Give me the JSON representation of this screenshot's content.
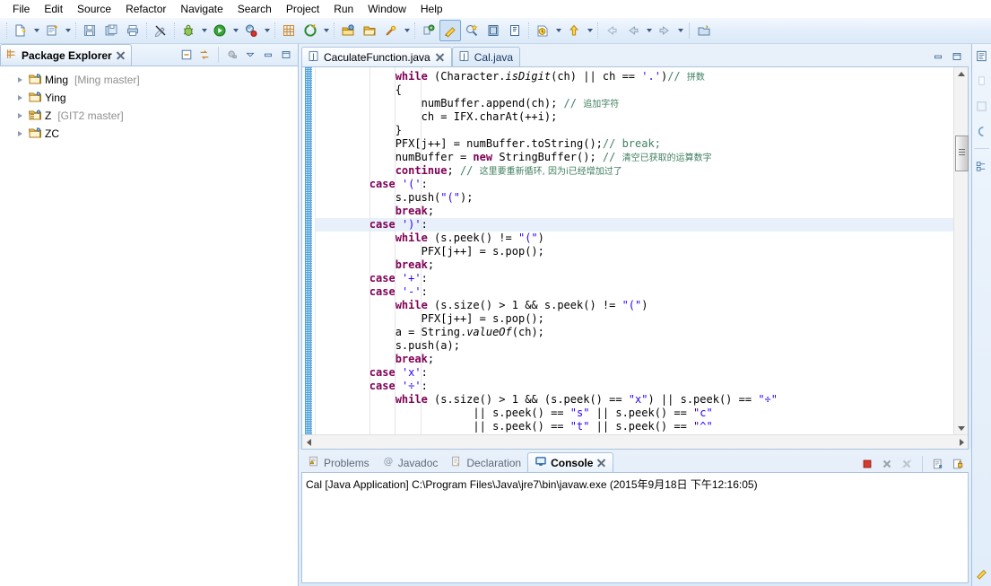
{
  "app": {
    "title": "Eclipse IDE"
  },
  "menubar": {
    "items": [
      {
        "label": "File"
      },
      {
        "label": "Edit"
      },
      {
        "label": "Source"
      },
      {
        "label": "Refactor"
      },
      {
        "label": "Navigate"
      },
      {
        "label": "Search"
      },
      {
        "label": "Project"
      },
      {
        "label": "Run"
      },
      {
        "label": "Window"
      },
      {
        "label": "Help"
      }
    ]
  },
  "toolbar": {
    "items": [
      {
        "name": "new-icon",
        "tip": "New"
      },
      {
        "name": "new-dropdown-arrow-icon",
        "tip": "New menu"
      },
      {
        "name": "new-java-class-icon",
        "tip": "New Java Class"
      },
      {
        "name": "new-java-class-dropdown-arrow-icon",
        "tip": "New Java Class menu"
      },
      {
        "name": "save-icon",
        "tip": "Save"
      },
      {
        "name": "save-all-icon",
        "tip": "Save All"
      },
      {
        "name": "print-icon",
        "tip": "Print"
      },
      {
        "name": "toggle-mark-occurrences-icon",
        "tip": "Toggle Mark Occurrences"
      },
      {
        "name": "debug-icon",
        "tip": "Debug"
      },
      {
        "name": "debug-dropdown-arrow-icon",
        "tip": "Debug menu"
      },
      {
        "name": "run-icon",
        "tip": "Run"
      },
      {
        "name": "run-dropdown-arrow-icon",
        "tip": "Run menu"
      },
      {
        "name": "external-tools-icon",
        "tip": "External Tools"
      },
      {
        "name": "external-tools-dropdown-arrow-icon",
        "tip": "External Tools menu"
      },
      {
        "name": "new-package-icon",
        "tip": "New Java Package"
      },
      {
        "name": "open-type-icon",
        "tip": "Open Type"
      },
      {
        "name": "open-type-dropdown-arrow-icon",
        "tip": "Open Type menu"
      },
      {
        "name": "open-task-icon",
        "tip": "Open Task"
      },
      {
        "name": "search-folder-icon",
        "tip": "Search"
      },
      {
        "name": "link-icon",
        "tip": "Link"
      },
      {
        "name": "link-dropdown-arrow-icon",
        "tip": "Link menu"
      },
      {
        "name": "next-annotation-icon",
        "tip": "Next Annotation"
      },
      {
        "name": "pencil-highlight-icon",
        "tip": "Toggle Highlight"
      },
      {
        "name": "search-ref-icon",
        "tip": "Search References"
      },
      {
        "name": "show-whitespace-icon",
        "tip": "Show Whitespace Characters"
      },
      {
        "name": "show-print-margin-icon",
        "tip": "Show Print Margin"
      },
      {
        "name": "previous-edit-icon",
        "tip": "Previous Edit Location"
      },
      {
        "name": "previous-edit-dropdown-arrow-icon",
        "tip": "Previous Edit menu"
      },
      {
        "name": "next-edit-icon",
        "tip": "Next Edit Location"
      },
      {
        "name": "next-edit-dropdown-arrow-icon",
        "tip": "Next Edit menu"
      },
      {
        "name": "back-icon",
        "tip": "Back"
      },
      {
        "name": "back-dropdown-arrow-icon",
        "tip": "Back menu"
      },
      {
        "name": "forward-icon",
        "tip": "Forward"
      },
      {
        "name": "forward-dropdown-arrow-icon",
        "tip": "Forward menu"
      },
      {
        "name": "open-perspective-icon",
        "tip": "Open Perspective"
      }
    ]
  },
  "package_explorer": {
    "tab_label": "Package Explorer",
    "tools": [
      {
        "name": "collapse-all-icon"
      },
      {
        "name": "link-with-editor-icon"
      },
      {
        "name": "focus-on-active-task-icon"
      },
      {
        "name": "view-menu-icon"
      },
      {
        "name": "minimize-icon"
      },
      {
        "name": "maximize-icon"
      }
    ],
    "tree": [
      {
        "label": "Ming",
        "branch": "[Ming master]",
        "icon": "java-project-icon"
      },
      {
        "label": "Ying",
        "branch": "",
        "icon": "java-project-icon"
      },
      {
        "label": "Z",
        "branch": "[GIT2 master]",
        "icon": "java-project-icon"
      },
      {
        "label": "ZC",
        "branch": "",
        "icon": "java-project-icon"
      }
    ]
  },
  "editor": {
    "tabs": [
      {
        "label": "CaculateFunction.java",
        "active": true,
        "closable": true,
        "icon": "java-file-icon"
      },
      {
        "label": "Cal.java",
        "active": false,
        "closable": false,
        "icon": "java-file-icon"
      }
    ],
    "tools": [
      {
        "name": "minimize-icon"
      },
      {
        "name": "maximize-icon"
      }
    ],
    "highlighted_line_index": 11,
    "lines": [
      {
        "indent": 12,
        "tokens": [
          {
            "t": "while",
            "c": "kw"
          },
          {
            "t": " (Character.",
            "c": "plain"
          },
          {
            "t": "isDigit",
            "c": "ital"
          },
          {
            "t": "(ch) || ch == ",
            "c": "plain"
          },
          {
            "t": "'.'",
            "c": "str"
          },
          {
            "t": ")",
            "c": "plain"
          },
          {
            "t": "// ",
            "c": "cmt"
          },
          {
            "t": "拼数",
            "c": "cmt-cn"
          }
        ]
      },
      {
        "indent": 12,
        "tokens": [
          {
            "t": "{",
            "c": "plain"
          }
        ]
      },
      {
        "indent": 16,
        "tokens": [
          {
            "t": "numBuffer.append(ch); ",
            "c": "plain"
          },
          {
            "t": "// ",
            "c": "cmt"
          },
          {
            "t": "追加字符",
            "c": "cmt-cn"
          }
        ]
      },
      {
        "indent": 16,
        "tokens": [
          {
            "t": "ch = IFX.charAt(++i);",
            "c": "plain"
          }
        ]
      },
      {
        "indent": 12,
        "tokens": [
          {
            "t": "}",
            "c": "plain"
          }
        ]
      },
      {
        "indent": 12,
        "tokens": [
          {
            "t": "PFX[j++] = numBuffer.toString();",
            "c": "plain"
          },
          {
            "t": "// break;",
            "c": "cmt"
          }
        ]
      },
      {
        "indent": 12,
        "tokens": [
          {
            "t": "numBuffer = ",
            "c": "plain"
          },
          {
            "t": "new",
            "c": "kw"
          },
          {
            "t": " StringBuffer(); ",
            "c": "plain"
          },
          {
            "t": "// ",
            "c": "cmt"
          },
          {
            "t": "清空已获取的运算数字",
            "c": "cmt-cn"
          }
        ]
      },
      {
        "indent": 12,
        "tokens": [
          {
            "t": "continue",
            "c": "kw"
          },
          {
            "t": "; ",
            "c": "plain"
          },
          {
            "t": "// ",
            "c": "cmt"
          },
          {
            "t": "这里要重新循环, 因为i已经增加过了",
            "c": "cmt-cn"
          }
        ]
      },
      {
        "indent": 8,
        "tokens": [
          {
            "t": "case",
            "c": "kw"
          },
          {
            "t": " ",
            "c": "plain"
          },
          {
            "t": "'('",
            "c": "str"
          },
          {
            "t": ":",
            "c": "plain"
          }
        ]
      },
      {
        "indent": 12,
        "tokens": [
          {
            "t": "s.push(",
            "c": "plain"
          },
          {
            "t": "\"(\"",
            "c": "str"
          },
          {
            "t": ");",
            "c": "plain"
          }
        ]
      },
      {
        "indent": 12,
        "tokens": [
          {
            "t": "break",
            "c": "kw"
          },
          {
            "t": ";",
            "c": "plain"
          }
        ]
      },
      {
        "indent": 8,
        "tokens": [
          {
            "t": "case",
            "c": "kw"
          },
          {
            "t": " ",
            "c": "plain"
          },
          {
            "t": "')'",
            "c": "str"
          },
          {
            "t": ":",
            "c": "plain"
          }
        ]
      },
      {
        "indent": 12,
        "tokens": [
          {
            "t": "while",
            "c": "kw"
          },
          {
            "t": " (s.peek() != ",
            "c": "plain"
          },
          {
            "t": "\"(\"",
            "c": "str"
          },
          {
            "t": ")",
            "c": "plain"
          }
        ]
      },
      {
        "indent": 16,
        "tokens": [
          {
            "t": "PFX[j++] = s.pop();",
            "c": "plain"
          }
        ]
      },
      {
        "indent": 12,
        "tokens": [
          {
            "t": "break",
            "c": "kw"
          },
          {
            "t": ";",
            "c": "plain"
          }
        ]
      },
      {
        "indent": 8,
        "tokens": [
          {
            "t": "case",
            "c": "kw"
          },
          {
            "t": " ",
            "c": "plain"
          },
          {
            "t": "'+'",
            "c": "str"
          },
          {
            "t": ":",
            "c": "plain"
          }
        ]
      },
      {
        "indent": 8,
        "tokens": [
          {
            "t": "case",
            "c": "kw"
          },
          {
            "t": " ",
            "c": "plain"
          },
          {
            "t": "'-'",
            "c": "str"
          },
          {
            "t": ":",
            "c": "plain"
          }
        ]
      },
      {
        "indent": 12,
        "tokens": [
          {
            "t": "while",
            "c": "kw"
          },
          {
            "t": " (s.size() > 1 && s.peek() != ",
            "c": "plain"
          },
          {
            "t": "\"(\"",
            "c": "str"
          },
          {
            "t": ")",
            "c": "plain"
          }
        ]
      },
      {
        "indent": 16,
        "tokens": [
          {
            "t": "PFX[j++] = s.pop();",
            "c": "plain"
          }
        ]
      },
      {
        "indent": 12,
        "tokens": [
          {
            "t": "a = String.",
            "c": "plain"
          },
          {
            "t": "valueOf",
            "c": "ital"
          },
          {
            "t": "(ch);",
            "c": "plain"
          }
        ]
      },
      {
        "indent": 12,
        "tokens": [
          {
            "t": "s.push(a);",
            "c": "plain"
          }
        ]
      },
      {
        "indent": 12,
        "tokens": [
          {
            "t": "break",
            "c": "kw"
          },
          {
            "t": ";",
            "c": "plain"
          }
        ]
      },
      {
        "indent": 8,
        "tokens": [
          {
            "t": "case",
            "c": "kw"
          },
          {
            "t": " ",
            "c": "plain"
          },
          {
            "t": "'x'",
            "c": "str"
          },
          {
            "t": ":",
            "c": "plain"
          }
        ]
      },
      {
        "indent": 8,
        "tokens": [
          {
            "t": "case",
            "c": "kw"
          },
          {
            "t": " ",
            "c": "plain"
          },
          {
            "t": "'÷'",
            "c": "str"
          },
          {
            "t": ":",
            "c": "plain"
          }
        ]
      },
      {
        "indent": 12,
        "tokens": [
          {
            "t": "while",
            "c": "kw"
          },
          {
            "t": " (s.size() > 1 && (s.peek() == ",
            "c": "plain"
          },
          {
            "t": "\"x\"",
            "c": "str"
          },
          {
            "t": ") || s.peek() == ",
            "c": "plain"
          },
          {
            "t": "\"÷\"",
            "c": "str"
          }
        ]
      },
      {
        "indent": 24,
        "tokens": [
          {
            "t": "|| s.peek() == ",
            "c": "plain"
          },
          {
            "t": "\"s\"",
            "c": "str"
          },
          {
            "t": " || s.peek() == ",
            "c": "plain"
          },
          {
            "t": "\"c\"",
            "c": "str"
          }
        ]
      },
      {
        "indent": 24,
        "tokens": [
          {
            "t": "|| s.peek() == ",
            "c": "plain"
          },
          {
            "t": "\"t\"",
            "c": "str"
          },
          {
            "t": " || s.peek() == ",
            "c": "plain"
          },
          {
            "t": "\"^\"",
            "c": "str"
          }
        ]
      }
    ]
  },
  "console_panel": {
    "tabs": [
      {
        "label": "Problems",
        "active": false,
        "icon": "problems-icon"
      },
      {
        "label": "Javadoc",
        "active": false,
        "icon": "javadoc-icon"
      },
      {
        "label": "Declaration",
        "active": false,
        "icon": "declaration-icon"
      },
      {
        "label": "Console",
        "active": true,
        "icon": "console-icon"
      }
    ],
    "tools": [
      {
        "name": "terminate-icon",
        "color": "#d83b2b"
      },
      {
        "name": "remove-launch-icon"
      },
      {
        "name": "remove-all-terminated-icon"
      },
      {
        "name": "clear-console-icon"
      },
      {
        "name": "scroll-lock-icon"
      },
      {
        "name": "pin-console-icon"
      },
      {
        "name": "display-selected-console-icon"
      },
      {
        "name": "open-console-icon"
      },
      {
        "name": "view-menu-icon"
      },
      {
        "name": "minimize-icon"
      },
      {
        "name": "maximize-icon"
      }
    ],
    "output": "Cal [Java Application] C:\\Program Files\\Java\\jre7\\bin\\javaw.exe (2015年9月18日 下午12:16:05)"
  },
  "right_strip": {
    "items": [
      {
        "name": "outline-view-icon"
      },
      {
        "name": "outline-entry-icon"
      },
      {
        "name": "outline-box-icon"
      },
      {
        "name": "outline-method-icon"
      },
      {
        "name": "task-list-icon"
      },
      {
        "name": "highlight-pen-icon"
      }
    ]
  },
  "colors": {
    "keyword": "#7f0055",
    "string": "#2a00ff",
    "comment": "#3f7f5f",
    "line_highlight": "#e8f1fb",
    "tab_border": "#a9c3de",
    "terminate_red": "#d83b2b"
  }
}
